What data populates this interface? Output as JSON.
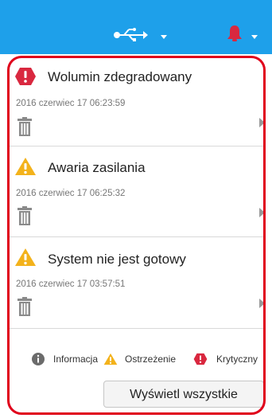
{
  "events": [
    {
      "severity": "critical",
      "title": "Wolumin zdegradowany",
      "time": "2016 czerwiec 17 06:23:59"
    },
    {
      "severity": "warning",
      "title": "Awaria zasilania",
      "time": "2016 czerwiec 17 06:25:32"
    },
    {
      "severity": "warning",
      "title": "System nie jest gotowy",
      "time": "2016 czerwiec 17 03:57:51"
    }
  ],
  "legend": {
    "info": "Informacja",
    "warning": "Ostrzeżenie",
    "critical": "Krytyczny"
  },
  "view_all_button": "Wyświetl wszystkie",
  "colors": {
    "topbar": "#1ea0ea",
    "critical": "#d9283f",
    "warning": "#f3b21b",
    "outline": "#e0001b"
  },
  "icons": [
    "usb-icon",
    "bell-icon",
    "critical-icon",
    "warning-icon",
    "trash-icon",
    "chevron-right-icon",
    "info-icon"
  ]
}
